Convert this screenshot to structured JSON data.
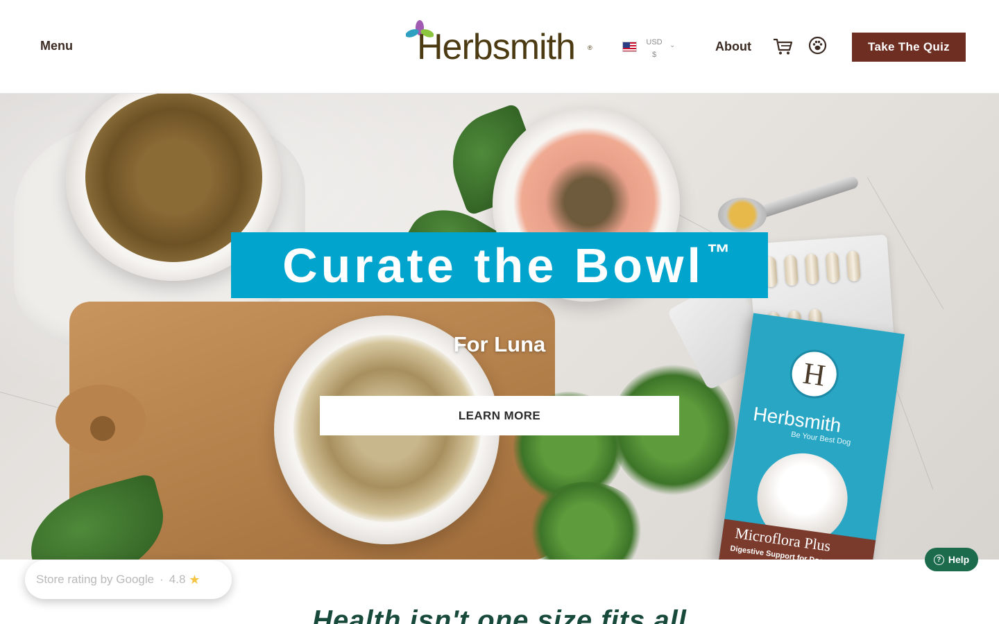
{
  "header": {
    "menu_label": "Menu",
    "logo_text": "Herbsmith",
    "logo_registered": "®",
    "currency_code": "USD",
    "currency_symbol": "$",
    "about_label": "About",
    "quiz_label": "Take The Quiz"
  },
  "hero": {
    "title": "Curate the Bowl",
    "title_mark": "™",
    "subtitle": "For Luna",
    "cta_label": "LEARN MORE",
    "product": {
      "brand": "Herbsmith",
      "tagline": "Be Your Best Dog",
      "box_letter": "H",
      "name": "Microflora Plus",
      "description": "Digestive Support for Dogs & Cats"
    }
  },
  "rating_badge": {
    "source": "Store rating by Google",
    "separator": "·",
    "score": "4.8",
    "star": "★"
  },
  "help": {
    "label": "Help",
    "icon_glyph": "?"
  },
  "tagline": "Health isn't one size fits all",
  "colors": {
    "quiz_button": "#6e2e22",
    "hero_title_bg": "#00a4cc",
    "help_button": "#1b6b4c",
    "tagline": "#184a3b"
  },
  "icons": {
    "cart": "cart-icon",
    "account": "paw-icon",
    "currency_flag": "us-flag-icon",
    "dropdown": "chevron-down-icon"
  }
}
